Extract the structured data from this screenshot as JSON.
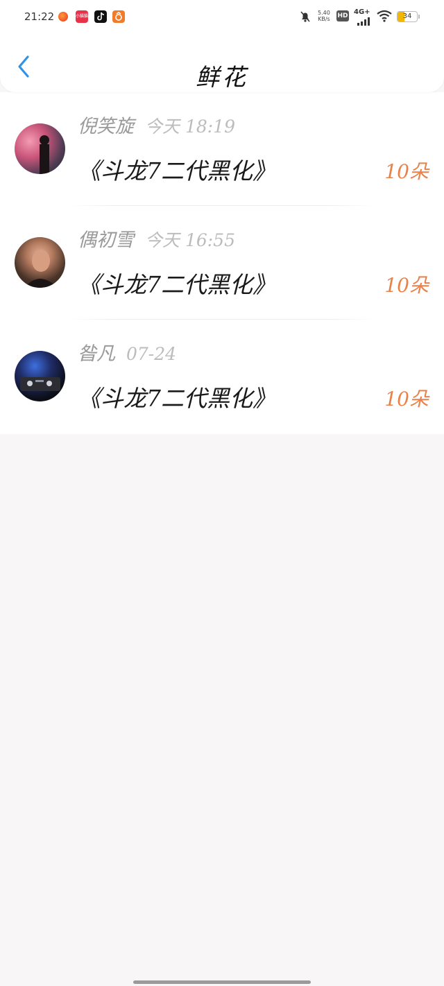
{
  "status_bar": {
    "time": "21:22",
    "app_badge_text": "小猫猫",
    "net_speed_value": "5.40",
    "net_speed_unit": "KB/s",
    "hd_label": "HD",
    "network_label": "4G+",
    "battery_level": "34",
    "battery_fraction": 0.34,
    "battery_color": "#f2b705"
  },
  "navbar": {
    "title": "鲜花",
    "back_icon": "chevron-left-icon",
    "accent_color": "#2f93e8"
  },
  "items": [
    {
      "name": "倪笑旋",
      "time": "今天  18:19",
      "title": "《斗龙7二代黑化》",
      "count": "10朵"
    },
    {
      "name": "偶初雪",
      "time": "今天  16:55",
      "title": "《斗龙7二代黑化》",
      "count": "10朵"
    },
    {
      "name": "昝凡",
      "time": "07-24",
      "title": "《斗龙7二代黑化》",
      "count": "10朵"
    }
  ],
  "colors": {
    "count_color": "#e9824a",
    "meta_color": "#a9a9a9",
    "background": "#f8f6f7"
  }
}
